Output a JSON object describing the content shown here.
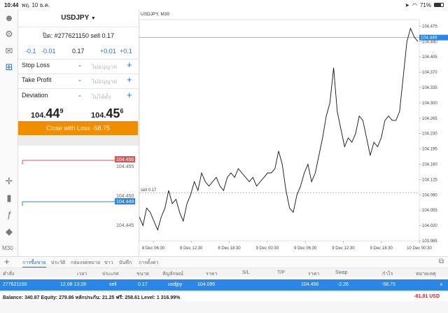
{
  "status": {
    "time": "10:44",
    "date": "พฤ. 10 ธ.ค.",
    "battery": "71%",
    "battery_level": 0.71
  },
  "sidebar": {
    "icons": [
      "person-icon",
      "settings-gear-icon",
      "chat-icon",
      "add-order-icon",
      "crosshair-icon",
      "candlestick-icon",
      "function-icon",
      "objects-icon"
    ],
    "timeframe": "M30"
  },
  "trade": {
    "symbol": "USDJPY",
    "order_line": "ปิด: #277621150 sell 0.17",
    "volume_steps": [
      "-0.1",
      "-0.01",
      "0.17",
      "+0.01",
      "+0.1"
    ],
    "stop_loss": {
      "label": "Stop Loss",
      "value": "ไม่อนุญาต"
    },
    "take_profit": {
      "label": "Take Profit",
      "value": "ไม่อนุญาต"
    },
    "deviation": {
      "label": "Deviation",
      "value": "ไม่ได้ตั้ง"
    },
    "bid": {
      "small": "104.",
      "big": "44",
      "sup": "9"
    },
    "ask": {
      "small": "104.",
      "big": "45",
      "sup": "6"
    },
    "close_button": "Close with Loss -58.75"
  },
  "mini_chart": {
    "ask_label": "104.456",
    "bid_label": "104.449",
    "ticks": [
      "104.455",
      "104.450",
      "104.445"
    ]
  },
  "chart_data": {
    "type": "line",
    "title": "USDJPY, M30",
    "ylim": [
      103.985,
      104.49
    ],
    "y_ticks": [
      104.475,
      104.44,
      104.405,
      104.37,
      104.335,
      104.3,
      104.265,
      104.23,
      104.195,
      104.16,
      104.125,
      104.09,
      104.055,
      104.02,
      103.985
    ],
    "x_ticks": [
      "8 Dec 06:30",
      "8 Dec 12:30",
      "8 Dec 18:30",
      "9 Dec 00:30",
      "9 Dec 06:30",
      "9 Dec 12:30",
      "9 Dec 18:30",
      "10 Dec 00:30"
    ],
    "current_price": 104.449,
    "current_price_label": "104.449",
    "order_price": 104.095,
    "order_label": "sell 0.17",
    "values": [
      104.04,
      104.02,
      104.06,
      104.05,
      104.03,
      104.01,
      104.04,
      104.06,
      104.1,
      104.07,
      104.08,
      104.05,
      104.03,
      104.07,
      104.09,
      104.12,
      104.1,
      104.14,
      104.12,
      104.11,
      104.12,
      104.13,
      104.11,
      104.1,
      104.13,
      104.14,
      104.13,
      104.15,
      104.14,
      104.13,
      104.12,
      104.13,
      104.11,
      104.12,
      104.13,
      104.14,
      104.14,
      104.15,
      104.19,
      104.16,
      104.1,
      104.06,
      104.05,
      104.09,
      104.11,
      104.14,
      104.16,
      104.12,
      104.14,
      104.18,
      104.22,
      104.27,
      104.3,
      104.38,
      104.28,
      104.24,
      104.2,
      104.22,
      104.21,
      104.23,
      104.27,
      104.26,
      104.22,
      104.18,
      104.21,
      104.2,
      104.22,
      104.26,
      104.27,
      104.26,
      104.26,
      104.28,
      104.36,
      104.44,
      104.47,
      104.45,
      104.44
    ]
  },
  "tabs": [
    "การซื้อขาย",
    "ประวัติ",
    "กล่องจดหมาย",
    "ข่าว",
    "บันทึก",
    "การตั้งค่า"
  ],
  "table": {
    "headers": [
      "คำสั่ง",
      "เวลา",
      "ประเภท",
      "ขนาด",
      "สัญลักษณ์",
      "ราคา",
      "S/L",
      "T/P",
      "ราคา",
      "Swap",
      "กำไร",
      "หมายเหตุ"
    ],
    "row": [
      "277621150",
      "12.08 13:28",
      "sell",
      "0.17",
      "usdjpy",
      "104.095",
      "",
      "",
      "104.456",
      "-2.26",
      "-58.75",
      ""
    ]
  },
  "footer": {
    "balance": "Balance: 340.87 Equity: 279.86 หลักประกัน: 21.25 ฟรี: 258.61 Level: 1 316.99%",
    "total": "-61.01  USD"
  }
}
